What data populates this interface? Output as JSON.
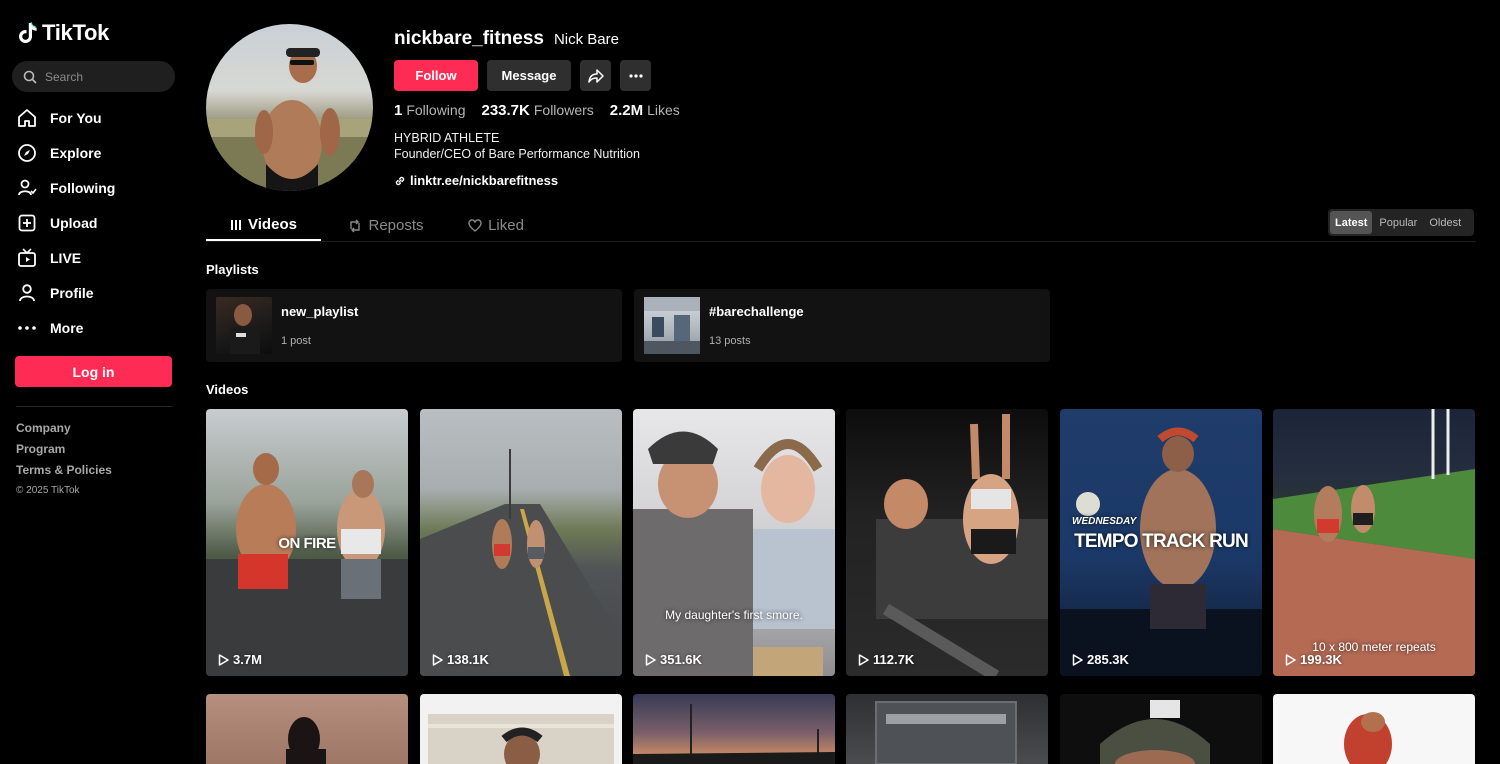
{
  "app": {
    "name": "TikTok"
  },
  "search": {
    "placeholder": "Search"
  },
  "nav": [
    {
      "label": "For You",
      "icon": "home-icon"
    },
    {
      "label": "Explore",
      "icon": "compass-icon"
    },
    {
      "label": "Following",
      "icon": "following-icon"
    },
    {
      "label": "Upload",
      "icon": "upload-icon"
    },
    {
      "label": "LIVE",
      "icon": "live-icon"
    },
    {
      "label": "Profile",
      "icon": "profile-icon"
    },
    {
      "label": "More",
      "icon": "more-icon"
    }
  ],
  "login": {
    "label": "Log in"
  },
  "footer": {
    "links": [
      "Company",
      "Program",
      "Terms & Policies"
    ],
    "copyright": "© 2025 TikTok"
  },
  "profile": {
    "username": "nickbare_fitness",
    "nickname": "Nick Bare",
    "follow_label": "Follow",
    "message_label": "Message",
    "stats": [
      {
        "value": "1",
        "label": "Following"
      },
      {
        "value": "233.7K",
        "label": "Followers"
      },
      {
        "value": "2.2M",
        "label": "Likes"
      }
    ],
    "bio_line1": "HYBRID ATHLETE",
    "bio_line2": "Founder/CEO of Bare Performance Nutrition",
    "link": "linktr.ee/nickbarefitness"
  },
  "tabs": [
    {
      "label": "Videos",
      "active": true
    },
    {
      "label": "Reposts",
      "active": false
    },
    {
      "label": "Liked",
      "active": false
    }
  ],
  "sort": {
    "options": [
      "Latest",
      "Popular",
      "Oldest"
    ],
    "selected": "Latest"
  },
  "playlists": {
    "title": "Playlists",
    "items": [
      {
        "name": "new_playlist",
        "count": "1 post"
      },
      {
        "name": "#barechallenge",
        "count": "13 posts"
      }
    ]
  },
  "videos": {
    "title": "Videos",
    "items": [
      {
        "views": "3.7M",
        "caption": "ON FIRE"
      },
      {
        "views": "138.1K",
        "caption": ""
      },
      {
        "views": "351.6K",
        "caption": "My daughter's first smore."
      },
      {
        "views": "112.7K",
        "caption": ""
      },
      {
        "views": "285.3K",
        "caption_small": "WEDNESDAY",
        "caption": "TEMPO TRACK RUN"
      },
      {
        "views": "199.3K",
        "caption": "10 x 800 meter repeats"
      }
    ]
  },
  "colors": {
    "accent": "#fe2c55",
    "background": "#000000",
    "surface": "#121212"
  }
}
